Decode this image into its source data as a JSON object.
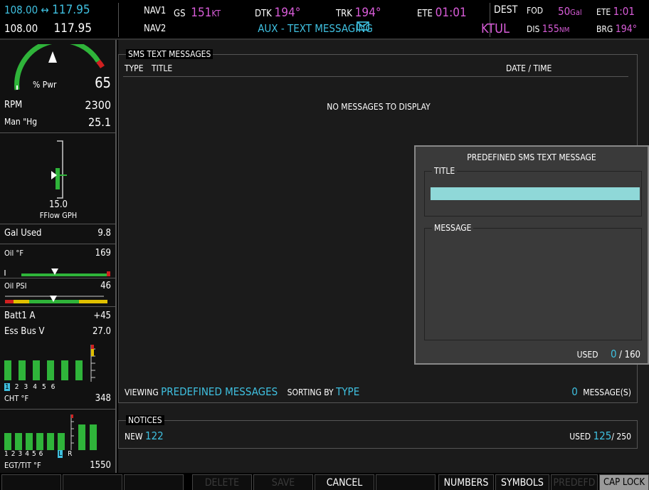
{
  "top": {
    "com_active": "108.00",
    "com_standby": "117.95",
    "com2_active": "108.00",
    "com2_standby": "117.95",
    "swap": "↔",
    "nav1": "NAV1",
    "nav2": "NAV2",
    "gs_label": "GS",
    "gs_value": "151",
    "gs_unit": "KT",
    "dtk_label": "DTK",
    "dtk_value": "194°",
    "trk_label": "TRK",
    "trk_value": "194°",
    "ete_label": "ETE",
    "ete_value": "01:01",
    "page_title": "AUX - TEXT MESSAGING",
    "dest_label": "DEST",
    "dest_value": "FOD",
    "fuel_value": "50",
    "fuel_unit": "Gal",
    "ete2_label": "ETE",
    "ete2_value": "1:01",
    "waypoint": "KTUL",
    "dis_label": "DIS",
    "dis_value": "155",
    "dis_unit": "NM",
    "brg_label": "BRG",
    "brg_value": "194°"
  },
  "engine": {
    "pwr_label": "% Pwr",
    "pwr_value": "65",
    "rpm_label": "RPM",
    "rpm_value": "2300",
    "man_label": "Man \"Hg",
    "man_value": "25.1",
    "fflow_value": "15.0",
    "fflow_label": "FFlow GPH",
    "gal_used_label": "Gal Used",
    "gal_used_value": "9.8",
    "oil_f_label": "Oil °F",
    "oil_f_value": "169",
    "oil_psi_label": "Oil PSI",
    "oil_psi_value": "46",
    "batt_label": "Batt1 A",
    "batt_value": "+45",
    "bus_label": "Ess Bus V",
    "bus_value": "27.0",
    "cht_cells": [
      "1",
      "2",
      "3",
      "4",
      "5",
      "6"
    ],
    "cht_label": "CHT °F",
    "cht_value": "348",
    "egt_cells": [
      "1",
      "2",
      "3",
      "4",
      "5",
      "6"
    ],
    "egt_lr": [
      "L",
      "R"
    ],
    "egt_label": "EGT/TIT °F",
    "egt_value": "1550"
  },
  "sms": {
    "frame_title": "SMS TEXT MESSAGES",
    "col_type": "TYPE",
    "col_title": "TITLE",
    "col_datetime": "DATE / TIME",
    "empty_text": "NO MESSAGES TO DISPLAY",
    "viewing_label": "VIEWING",
    "viewing_value": "PREDEFINED MESSAGES",
    "sorting_label": "SORTING BY",
    "sorting_value": "TYPE",
    "count_value": "0",
    "count_label": "MESSAGE(S)"
  },
  "notices": {
    "frame_title": "NOTICES",
    "new_label": "NEW",
    "new_value": "122",
    "used_label": "USED",
    "used_value": "125",
    "used_total": "/ 250"
  },
  "popup": {
    "title": "PREDEFINED SMS TEXT MESSAGE",
    "title_label": "TITLE",
    "title_value": "",
    "message_label": "MESSAGE",
    "message_value": "",
    "used_label": "USED",
    "used_value": "0",
    "used_total": "/ 160"
  },
  "softkeys": {
    "delete": "DELETE",
    "save": "SAVE",
    "cancel": "CANCEL",
    "numbers": "NUMBERS",
    "symbols": "SYMBOLS",
    "predefd": "PREDEFD",
    "cap_lock": "CAP LOCK"
  },
  "colors": {
    "cyan": "#3fc0e0",
    "magenta": "#d85cd8",
    "green": "#2fb43a",
    "input_fill": "#8fd8d8"
  }
}
